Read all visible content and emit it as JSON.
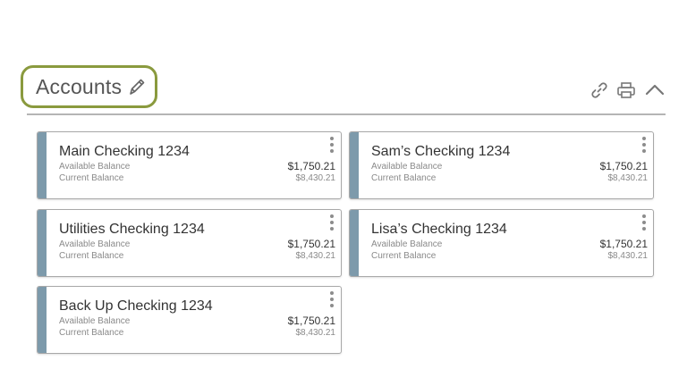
{
  "header": {
    "title": "Accounts"
  },
  "icons": {
    "edit": "pencil-icon",
    "link": "link-icon",
    "print": "printer-icon",
    "collapse": "chevron-up-icon"
  },
  "colors": {
    "header_outline": "#8a9a3e",
    "card_accent": "#7d9aab"
  },
  "accounts": [
    {
      "name": "Main Checking 1234",
      "available_label": "Available Balance",
      "current_label": "Current Balance",
      "available_balance": "$1,750.21",
      "current_balance": "$8,430.21"
    },
    {
      "name": "Sam’s Checking 1234",
      "available_label": "Available Balance",
      "current_label": "Current Balance",
      "available_balance": "$1,750.21",
      "current_balance": "$8,430.21"
    },
    {
      "name": "Utilities Checking 1234",
      "available_label": "Available Balance",
      "current_label": "Current Balance",
      "available_balance": "$1,750.21",
      "current_balance": "$8,430.21"
    },
    {
      "name": "Lisa’s Checking 1234",
      "available_label": "Available Balance",
      "current_label": "Current Balance",
      "available_balance": "$1,750.21",
      "current_balance": "$8,430.21"
    },
    {
      "name": "Back Up Checking 1234",
      "available_label": "Available Balance",
      "current_label": "Current Balance",
      "available_balance": "$1,750.21",
      "current_balance": "$8,430.21"
    }
  ]
}
